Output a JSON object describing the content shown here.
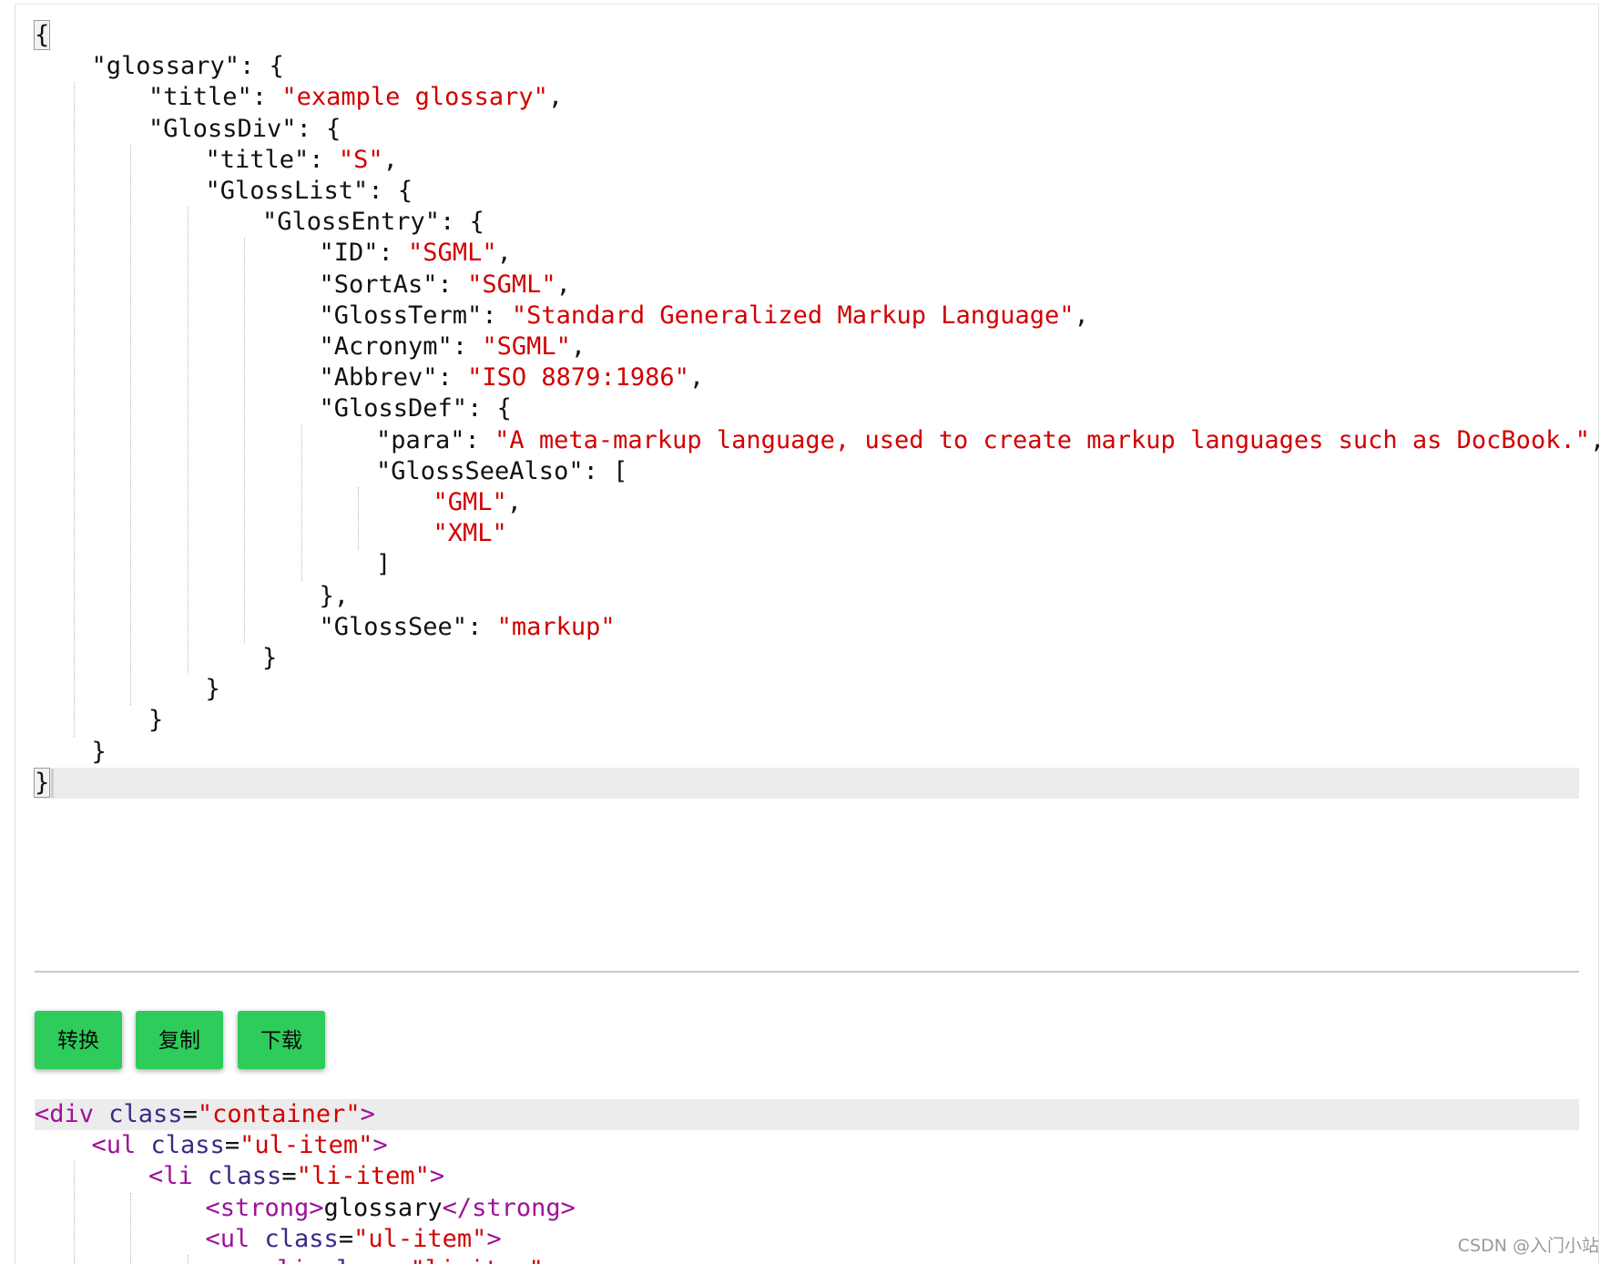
{
  "json_lines": [
    [
      {
        "t": "{",
        "c": "punc",
        "hl": true
      }
    ],
    [
      {
        "t": "\"glossary\"",
        "c": "key"
      },
      {
        "t": ": {",
        "c": "punc"
      }
    ],
    [
      {
        "t": "\"title\"",
        "c": "key"
      },
      {
        "t": ": ",
        "c": "punc"
      },
      {
        "t": "\"example glossary\"",
        "c": "str"
      },
      {
        "t": ",",
        "c": "punc"
      }
    ],
    [
      {
        "t": "\"GlossDiv\"",
        "c": "key"
      },
      {
        "t": ": {",
        "c": "punc"
      }
    ],
    [
      {
        "t": "\"title\"",
        "c": "key"
      },
      {
        "t": ": ",
        "c": "punc"
      },
      {
        "t": "\"S\"",
        "c": "str"
      },
      {
        "t": ",",
        "c": "punc"
      }
    ],
    [
      {
        "t": "\"GlossList\"",
        "c": "key"
      },
      {
        "t": ": {",
        "c": "punc"
      }
    ],
    [
      {
        "t": "\"GlossEntry\"",
        "c": "key"
      },
      {
        "t": ": {",
        "c": "punc"
      }
    ],
    [
      {
        "t": "\"ID\"",
        "c": "key"
      },
      {
        "t": ": ",
        "c": "punc"
      },
      {
        "t": "\"SGML\"",
        "c": "str"
      },
      {
        "t": ",",
        "c": "punc"
      }
    ],
    [
      {
        "t": "\"SortAs\"",
        "c": "key"
      },
      {
        "t": ": ",
        "c": "punc"
      },
      {
        "t": "\"SGML\"",
        "c": "str"
      },
      {
        "t": ",",
        "c": "punc"
      }
    ],
    [
      {
        "t": "\"GlossTerm\"",
        "c": "key"
      },
      {
        "t": ": ",
        "c": "punc"
      },
      {
        "t": "\"Standard Generalized Markup Language\"",
        "c": "str"
      },
      {
        "t": ",",
        "c": "punc"
      }
    ],
    [
      {
        "t": "\"Acronym\"",
        "c": "key"
      },
      {
        "t": ": ",
        "c": "punc"
      },
      {
        "t": "\"SGML\"",
        "c": "str"
      },
      {
        "t": ",",
        "c": "punc"
      }
    ],
    [
      {
        "t": "\"Abbrev\"",
        "c": "key"
      },
      {
        "t": ": ",
        "c": "punc"
      },
      {
        "t": "\"ISO 8879:1986\"",
        "c": "str"
      },
      {
        "t": ",",
        "c": "punc"
      }
    ],
    [
      {
        "t": "\"GlossDef\"",
        "c": "key"
      },
      {
        "t": ": {",
        "c": "punc"
      }
    ],
    [
      {
        "t": "\"para\"",
        "c": "key"
      },
      {
        "t": ": ",
        "c": "punc"
      },
      {
        "t": "\"A meta-markup language, used to create markup languages such as DocBook.\"",
        "c": "str"
      },
      {
        "t": ",",
        "c": "punc"
      }
    ],
    [
      {
        "t": "\"GlossSeeAlso\"",
        "c": "key"
      },
      {
        "t": ": [",
        "c": "punc"
      }
    ],
    [
      {
        "t": "\"GML\"",
        "c": "str"
      },
      {
        "t": ",",
        "c": "punc"
      }
    ],
    [
      {
        "t": "\"XML\"",
        "c": "str"
      }
    ],
    [
      {
        "t": "]",
        "c": "punc"
      }
    ],
    [
      {
        "t": "},",
        "c": "punc"
      }
    ],
    [
      {
        "t": "\"GlossSee\"",
        "c": "key"
      },
      {
        "t": ": ",
        "c": "punc"
      },
      {
        "t": "\"markup\"",
        "c": "str"
      }
    ],
    [
      {
        "t": "}",
        "c": "punc"
      }
    ],
    [
      {
        "t": "}",
        "c": "punc"
      }
    ],
    [
      {
        "t": "}",
        "c": "punc"
      }
    ],
    [
      {
        "t": "}",
        "c": "punc"
      }
    ],
    [
      {
        "t": "}",
        "c": "punc",
        "hl": true
      }
    ]
  ],
  "json_indents": [
    0,
    1,
    2,
    2,
    3,
    3,
    4,
    5,
    5,
    5,
    5,
    5,
    5,
    6,
    6,
    7,
    7,
    6,
    5,
    5,
    4,
    3,
    2,
    1,
    0
  ],
  "json_active_line": 24,
  "buttons": {
    "convert": "转换",
    "copy": "复制",
    "download": "下载"
  },
  "html_lines": [
    [
      {
        "t": "<div ",
        "c": "tag"
      },
      {
        "t": "class",
        "c": "attr"
      },
      {
        "t": "=",
        "c": "text"
      },
      {
        "t": "\"container\"",
        "c": "val"
      },
      {
        "t": ">",
        "c": "tag"
      }
    ],
    [
      {
        "t": "<ul ",
        "c": "tag"
      },
      {
        "t": "class",
        "c": "attr"
      },
      {
        "t": "=",
        "c": "text"
      },
      {
        "t": "\"ul-item\"",
        "c": "val"
      },
      {
        "t": ">",
        "c": "tag"
      }
    ],
    [
      {
        "t": "<li ",
        "c": "tag"
      },
      {
        "t": "class",
        "c": "attr"
      },
      {
        "t": "=",
        "c": "text"
      },
      {
        "t": "\"li-item\"",
        "c": "val"
      },
      {
        "t": ">",
        "c": "tag"
      }
    ],
    [
      {
        "t": "<strong>",
        "c": "tag"
      },
      {
        "t": "glossary",
        "c": "text"
      },
      {
        "t": "</strong>",
        "c": "tag"
      }
    ],
    [
      {
        "t": "<ul ",
        "c": "tag"
      },
      {
        "t": "class",
        "c": "attr"
      },
      {
        "t": "=",
        "c": "text"
      },
      {
        "t": "\"ul-item\"",
        "c": "val"
      },
      {
        "t": ">",
        "c": "tag"
      }
    ],
    [
      {
        "t": "<li ",
        "c": "tag"
      },
      {
        "t": "class",
        "c": "attr"
      },
      {
        "t": "=",
        "c": "text"
      },
      {
        "t": "\"li-item\"",
        "c": "val"
      },
      {
        "t": ">",
        "c": "tag"
      }
    ]
  ],
  "html_indents": [
    0,
    1,
    2,
    3,
    3,
    4
  ],
  "html_active_line": 0,
  "watermark": "CSDN @入门小站"
}
